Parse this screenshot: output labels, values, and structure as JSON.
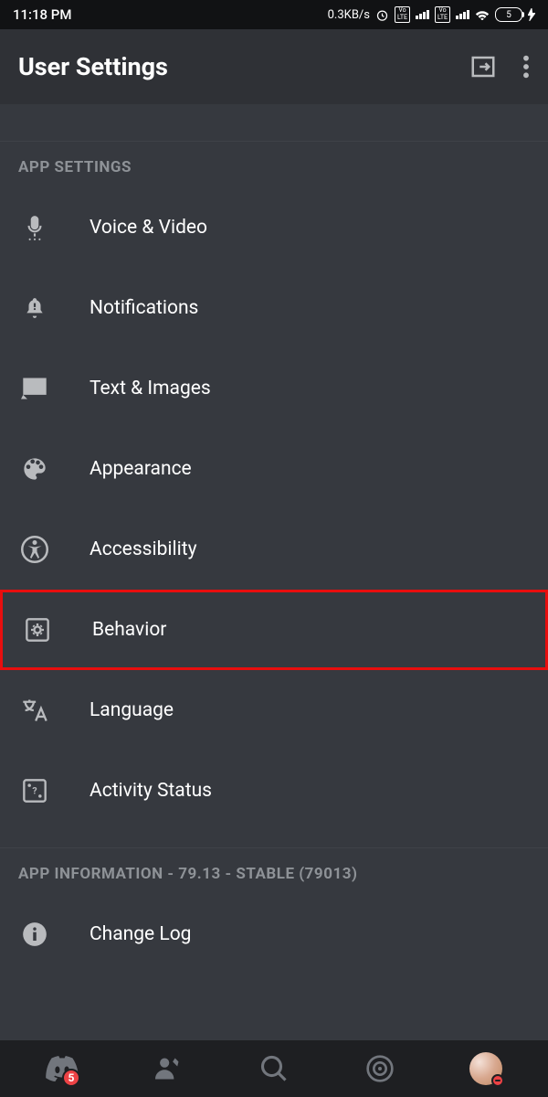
{
  "status_bar": {
    "time": "11:18 PM",
    "data_speed": "0.3KB/s",
    "battery_level": "5"
  },
  "header": {
    "title": "User Settings"
  },
  "sections": {
    "app_settings": {
      "title": "APP SETTINGS",
      "items": [
        {
          "icon": "mic-icon",
          "label": "Voice & Video"
        },
        {
          "icon": "bell-icon",
          "label": "Notifications"
        },
        {
          "icon": "image-icon",
          "label": "Text & Images"
        },
        {
          "icon": "palette-icon",
          "label": "Appearance"
        },
        {
          "icon": "accessibility-icon",
          "label": "Accessibility"
        },
        {
          "icon": "gear-box-icon",
          "label": "Behavior",
          "highlighted": true
        },
        {
          "icon": "language-icon",
          "label": "Language"
        },
        {
          "icon": "dice-icon",
          "label": "Activity Status"
        }
      ]
    },
    "app_information": {
      "title": "APP INFORMATION - 79.13 - STABLE (79013)",
      "items": [
        {
          "icon": "info-icon",
          "label": "Change Log"
        }
      ]
    }
  },
  "bottom_nav": {
    "badge_count": "5"
  }
}
